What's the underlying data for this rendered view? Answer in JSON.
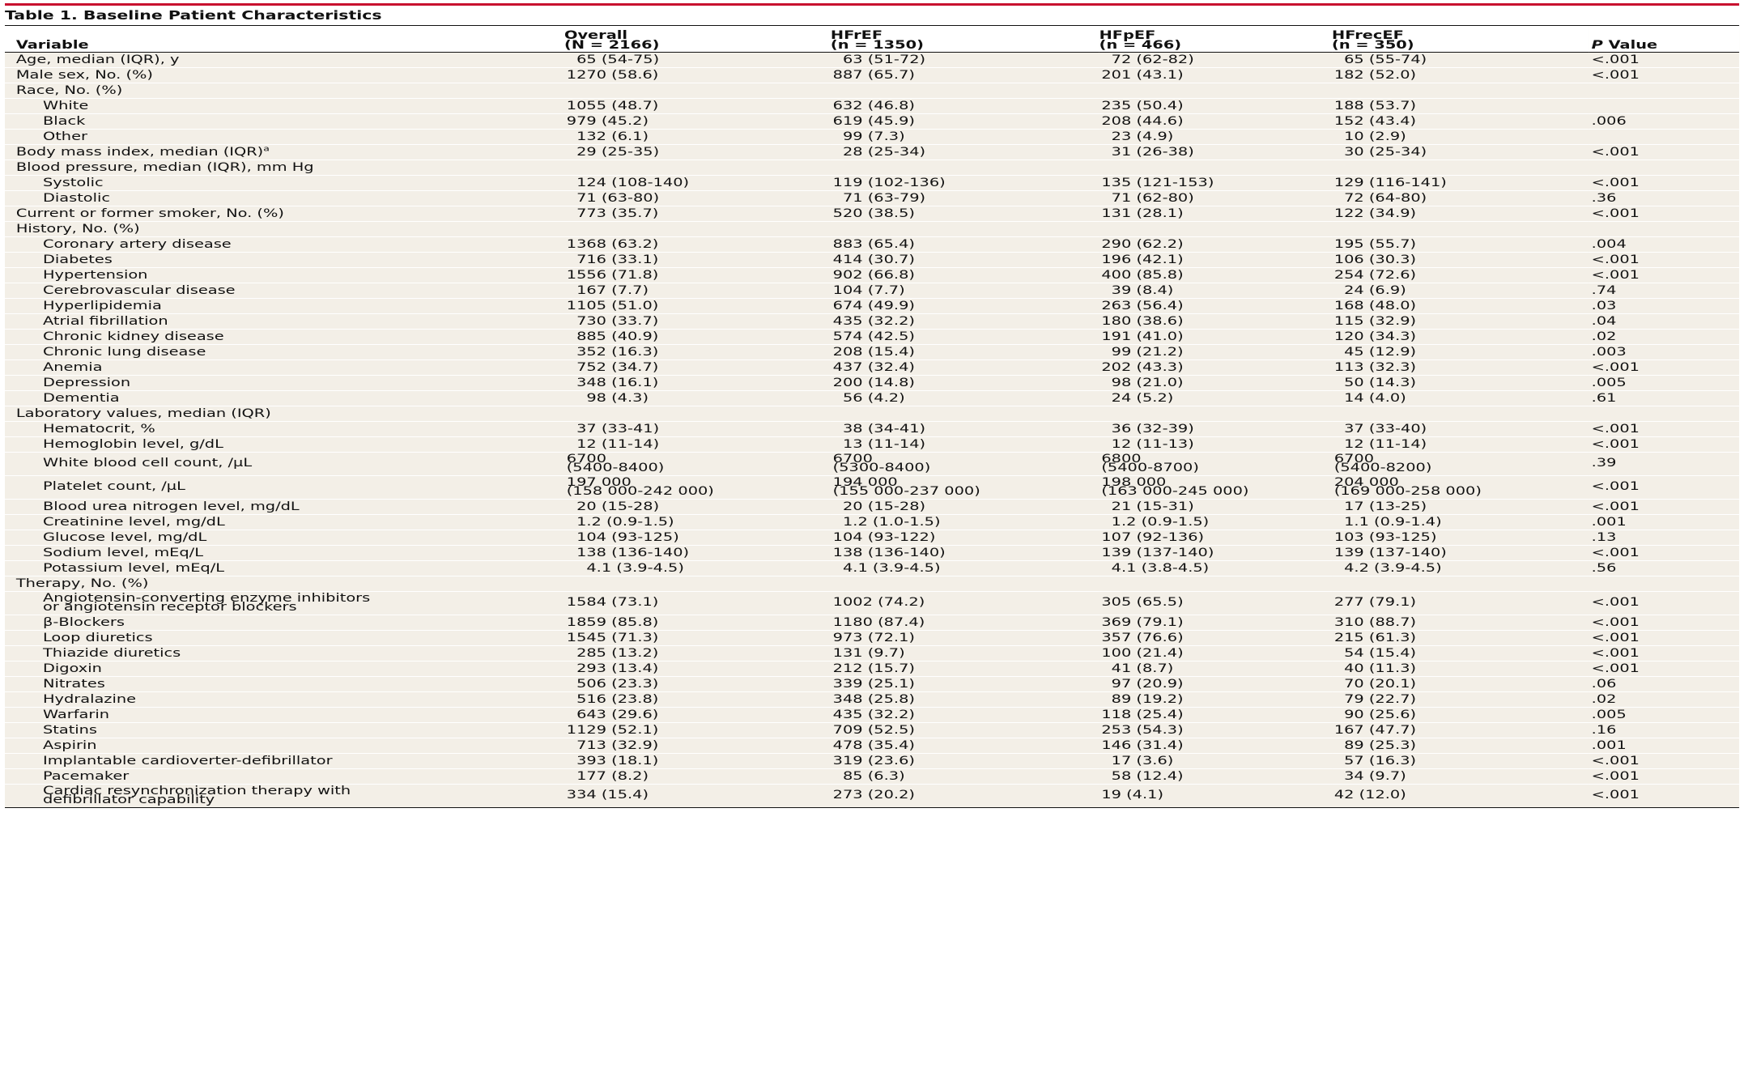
{
  "title": "Table 1. Baseline Patient Characteristics",
  "columns": {
    "variable": "Variable",
    "overall_name": "Overall",
    "overall_n": "(N = 2166)",
    "hfref_name": "HFrEF",
    "hfref_n": "(n = 1350)",
    "hfpef_name": "HFpEF",
    "hfpef_n": "(n = 466)",
    "hfrecef_name": "HFrecEF",
    "hfrecef_n": "(n = 350)",
    "p_italic": "P",
    "p_rest": " Value"
  },
  "rows": [
    {
      "label": "Age, median (IQR), y",
      "overall": "  65 (54-75)",
      "hfref": "  63 (51-72)",
      "hfpef": "  72 (62-82)",
      "hfrecef": "  65 (55-74)",
      "p": "<.001"
    },
    {
      "label": "Male sex, No. (%)",
      "overall": "1270 (58.6)",
      "hfref": "887 (65.7)",
      "hfpef": "201 (43.1)",
      "hfrecef": "182 (52.0)",
      "p": "<.001"
    },
    {
      "label": "Race, No. (%)",
      "overall": "",
      "hfref": "",
      "hfpef": "",
      "hfrecef": "",
      "p": ""
    },
    {
      "label": "White",
      "overall": "1055 (48.7)",
      "hfref": "632 (46.8)",
      "hfpef": "235 (50.4)",
      "hfrecef": "188 (53.7)",
      "p": ""
    },
    {
      "label": "Black",
      "overall": "979 (45.2)",
      "hfref": "619 (45.9)",
      "hfpef": "208 (44.6)",
      "hfrecef": "152 (43.4)",
      "p": ".006"
    },
    {
      "label": "Other",
      "overall": "  132 (6.1)",
      "hfref": "  99 (7.3)",
      "hfpef": "  23 (4.9)",
      "hfrecef": "  10 (2.9)",
      "p": ""
    },
    {
      "label": "Body mass index, median (IQR)",
      "label_sup": "a",
      "overall": "  29 (25-35)",
      "hfref": "  28 (25-34)",
      "hfpef": "  31 (26-38)",
      "hfrecef": "  30 (25-34)",
      "p": "<.001"
    },
    {
      "label": "Blood pressure, median (IQR), mm Hg",
      "overall": "",
      "hfref": "",
      "hfpef": "",
      "hfrecef": "",
      "p": ""
    },
    {
      "label": "Systolic",
      "overall": "  124 (108-140)",
      "hfref": "119 (102-136)",
      "hfpef": "135 (121-153)",
      "hfrecef": "129 (116-141)",
      "p": "<.001"
    },
    {
      "label": "Diastolic",
      "overall": "  71 (63-80)",
      "hfref": "  71 (63-79)",
      "hfpef": "  71 (62-80)",
      "hfrecef": "  72 (64-80)",
      "p": ".36"
    },
    {
      "label": "Current or former smoker, No. (%)",
      "overall": "  773 (35.7)",
      "hfref": "520 (38.5)",
      "hfpef": "131 (28.1)",
      "hfrecef": "122 (34.9)",
      "p": "<.001"
    },
    {
      "label": "History, No. (%)",
      "overall": "",
      "hfref": "",
      "hfpef": "",
      "hfrecef": "",
      "p": ""
    },
    {
      "label": "Coronary artery disease",
      "overall": "1368 (63.2)",
      "hfref": "883 (65.4)",
      "hfpef": "290 (62.2)",
      "hfrecef": "195 (55.7)",
      "p": ".004"
    },
    {
      "label": "Diabetes",
      "overall": "  716 (33.1)",
      "hfref": "414 (30.7)",
      "hfpef": "196 (42.1)",
      "hfrecef": "106 (30.3)",
      "p": "<.001"
    },
    {
      "label": "Hypertension",
      "overall": "1556 (71.8)",
      "hfref": "902 (66.8)",
      "hfpef": "400 (85.8)",
      "hfrecef": "254 (72.6)",
      "p": "<.001"
    },
    {
      "label": "Cerebrovascular disease",
      "overall": "  167 (7.7)",
      "hfref": "104 (7.7)",
      "hfpef": "  39 (8.4)",
      "hfrecef": "  24 (6.9)",
      "p": ".74"
    },
    {
      "label": "Hyperlipidemia",
      "overall": "1105 (51.0)",
      "hfref": "674 (49.9)",
      "hfpef": "263 (56.4)",
      "hfrecef": "168 (48.0)",
      "p": ".03"
    },
    {
      "label": "Atrial fibrillation",
      "overall": "  730 (33.7)",
      "hfref": "435 (32.2)",
      "hfpef": "180 (38.6)",
      "hfrecef": "115 (32.9)",
      "p": ".04"
    },
    {
      "label": "Chronic kidney disease",
      "overall": "  885 (40.9)",
      "hfref": "574 (42.5)",
      "hfpef": "191 (41.0)",
      "hfrecef": "120 (34.3)",
      "p": ".02"
    },
    {
      "label": "Chronic lung disease",
      "overall": "  352 (16.3)",
      "hfref": "208 (15.4)",
      "hfpef": "  99 (21.2)",
      "hfrecef": "  45 (12.9)",
      "p": ".003"
    },
    {
      "label": "Anemia",
      "overall": "  752 (34.7)",
      "hfref": "437 (32.4)",
      "hfpef": "202 (43.3)",
      "hfrecef": "113 (32.3)",
      "p": "<.001"
    },
    {
      "label": "Depression",
      "overall": "  348 (16.1)",
      "hfref": "200 (14.8)",
      "hfpef": "  98 (21.0)",
      "hfrecef": "  50 (14.3)",
      "p": ".005"
    },
    {
      "label": "Dementia",
      "overall": "    98 (4.3)",
      "hfref": "  56 (4.2)",
      "hfpef": "  24 (5.2)",
      "hfrecef": "  14 (4.0)",
      "p": ".61"
    },
    {
      "label": "Laboratory values, median (IQR)",
      "overall": "",
      "hfref": "",
      "hfpef": "",
      "hfrecef": "",
      "p": ""
    },
    {
      "label": "Hematocrit, %",
      "overall": "  37 (33-41)",
      "hfref": "  38 (34-41)",
      "hfpef": "  36 (32-39)",
      "hfrecef": "  37 (33-40)",
      "p": "<.001"
    },
    {
      "label": "Hemoglobin level, g/dL",
      "overall": "  12 (11-14)",
      "hfref": "  13 (11-14)",
      "hfpef": "  12 (11-13)",
      "hfrecef": "  12 (11-14)",
      "p": "<.001"
    },
    {
      "label": "White blood cell count, /µL",
      "overall": "6700\n(5400-8400)",
      "hfref": "6700\n(5300-8400)",
      "hfpef": "6800\n(5400-8700)",
      "hfrecef": "6700\n(5400-8200)",
      "p": ".39"
    },
    {
      "label": "Platelet count, /µL",
      "overall": "197 000\n(158 000-242 000)",
      "hfref": "194 000\n(155 000-237 000)",
      "hfpef": "198 000\n(163 000-245 000)",
      "hfrecef": "204 000\n(169 000-258 000)",
      "p": "<.001"
    },
    {
      "label": "Blood urea nitrogen level, mg/dL",
      "overall": "  20 (15-28)",
      "hfref": "  20 (15-28)",
      "hfpef": "  21 (15-31)",
      "hfrecef": "  17 (13-25)",
      "p": "<.001"
    },
    {
      "label": "Creatinine level, mg/dL",
      "overall": "  1.2 (0.9-1.5)",
      "hfref": "  1.2 (1.0-1.5)",
      "hfpef": "  1.2 (0.9-1.5)",
      "hfrecef": "  1.1 (0.9-1.4)",
      "p": ".001"
    },
    {
      "label": "Glucose level, mg/dL",
      "overall": "  104 (93-125)",
      "hfref": "104 (93-122)",
      "hfpef": "107 (92-136)",
      "hfrecef": "103 (93-125)",
      "p": ".13"
    },
    {
      "label": "Sodium level, mEq/L",
      "overall": "  138 (136-140)",
      "hfref": "138 (136-140)",
      "hfpef": "139 (137-140)",
      "hfrecef": "139 (137-140)",
      "p": "<.001"
    },
    {
      "label": "Potassium level, mEq/L",
      "overall": "    4.1 (3.9-4.5)",
      "hfref": "  4.1 (3.9-4.5)",
      "hfpef": "  4.1 (3.8-4.5)",
      "hfrecef": "  4.2 (3.9-4.5)",
      "p": ".56"
    },
    {
      "label": "Therapy, No. (%)",
      "overall": "",
      "hfref": "",
      "hfpef": "",
      "hfrecef": "",
      "p": ""
    },
    {
      "label": "Angiotensin-converting enzyme inhibitors\nor angiotensin receptor blockers",
      "overall": "1584 (73.1)",
      "hfref": "1002 (74.2)",
      "hfpef": "305 (65.5)",
      "hfrecef": "277 (79.1)",
      "p": "<.001"
    },
    {
      "label": "β-Blockers",
      "overall": "1859 (85.8)",
      "hfref": "1180 (87.4)",
      "hfpef": "369 (79.1)",
      "hfrecef": "310 (88.7)",
      "p": "<.001"
    },
    {
      "label": "Loop diuretics",
      "overall": "1545 (71.3)",
      "hfref": "973 (72.1)",
      "hfpef": "357 (76.6)",
      "hfrecef": "215 (61.3)",
      "p": "<.001"
    },
    {
      "label": "Thiazide diuretics",
      "overall": "  285 (13.2)",
      "hfref": "131 (9.7)",
      "hfpef": "100 (21.4)",
      "hfrecef": "  54 (15.4)",
      "p": "<.001"
    },
    {
      "label": "Digoxin",
      "overall": "  293 (13.4)",
      "hfref": "212 (15.7)",
      "hfpef": "  41 (8.7)",
      "hfrecef": "  40 (11.3)",
      "p": "<.001"
    },
    {
      "label": "Nitrates",
      "overall": "  506 (23.3)",
      "hfref": "339 (25.1)",
      "hfpef": "  97 (20.9)",
      "hfrecef": "  70 (20.1)",
      "p": ".06"
    },
    {
      "label": "Hydralazine",
      "overall": "  516 (23.8)",
      "hfref": "348 (25.8)",
      "hfpef": "  89 (19.2)",
      "hfrecef": "  79 (22.7)",
      "p": ".02"
    },
    {
      "label": "Warfarin",
      "overall": "  643 (29.6)",
      "hfref": "435 (32.2)",
      "hfpef": "118 (25.4)",
      "hfrecef": "  90 (25.6)",
      "p": ".005"
    },
    {
      "label": "Statins",
      "overall": "1129 (52.1)",
      "hfref": "709 (52.5)",
      "hfpef": "253 (54.3)",
      "hfrecef": "167 (47.7)",
      "p": ".16"
    },
    {
      "label": "Aspirin",
      "overall": "  713 (32.9)",
      "hfref": "478 (35.4)",
      "hfpef": "146 (31.4)",
      "hfrecef": "  89 (25.3)",
      "p": ".001"
    },
    {
      "label": "Implantable cardioverter-defibrillator",
      "overall": "  393 (18.1)",
      "hfref": "319 (23.6)",
      "hfpef": "  17 (3.6)",
      "hfrecef": "  57 (16.3)",
      "p": "<.001"
    },
    {
      "label": "Pacemaker",
      "overall": "  177 (8.2)",
      "hfref": "  85 (6.3)",
      "hfpef": "  58 (12.4)",
      "hfrecef": "  34 (9.7)",
      "p": "<.001"
    },
    {
      "label": "Cardiac resynchronization therapy with\ndefibrillator capability",
      "overall": "  334 (15.4)",
      "hfref": "273 (20.2)",
      "hfpef": "  19 (4.1)",
      "hfrecef": "  42 (12.0)",
      "p": "<.001"
    }
  ],
  "colors": {
    "accent_rule": "#c8102e",
    "table_bg": "#f3efe7",
    "text": "#111111"
  }
}
